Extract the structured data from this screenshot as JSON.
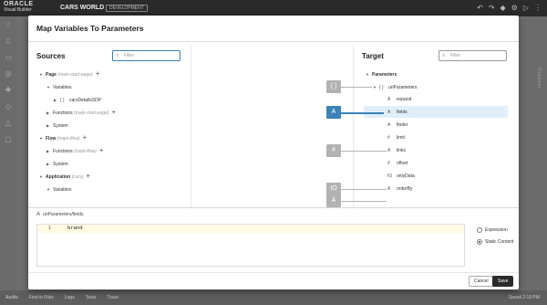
{
  "header": {
    "logo_top": "ORACLE",
    "logo_bottom": "Visual Builder",
    "app_name": "CARS WORLD",
    "env_badge": "DEVELOPMENT",
    "icons": [
      "undo-icon",
      "redo-icon",
      "diamond-icon",
      "gear-icon",
      "play-icon",
      "more-icon"
    ]
  },
  "right_rail": {
    "label": "Properties"
  },
  "dialog": {
    "title": "Map Variables To Parameters",
    "sources": {
      "title": "Sources",
      "filter_placeholder": "Filter",
      "tree": [
        {
          "label": "Page",
          "ctx": "(main-start-page)",
          "add": "+"
        },
        {
          "label": "Variables"
        },
        {
          "label": "carsDetailsSDP"
        },
        {
          "label": "Functions",
          "ctx": "(main-start-page)",
          "add": "+"
        },
        {
          "label": "System"
        },
        {
          "label": "Flow",
          "ctx": "(main-flow)",
          "add": "+"
        },
        {
          "label": "Functions",
          "ctx": "(main-flow)",
          "add": "+"
        },
        {
          "label": "System"
        },
        {
          "label": "Application",
          "ctx": "(cars)",
          "add": "+"
        },
        {
          "label": "Variables"
        }
      ]
    },
    "target": {
      "title": "Target",
      "filter_placeholder": "Filter",
      "tree": [
        {
          "label": "Parameters"
        },
        {
          "label": "uriParameters"
        },
        {
          "label": "expand"
        },
        {
          "label": "fields"
        },
        {
          "label": "finder"
        },
        {
          "label": "limit"
        },
        {
          "label": "links"
        },
        {
          "label": "offset"
        },
        {
          "label": "onlyData"
        },
        {
          "label": "orderBy"
        }
      ]
    },
    "mappings": [
      {
        "glyph": "{ }"
      },
      {
        "glyph": "A"
      },
      {
        "glyph": "#"
      },
      {
        "glyph": "IO"
      },
      {
        "glyph": "A"
      }
    ],
    "editor": {
      "path_label": "uriParameters/fields",
      "line_number": "1",
      "code": "brand",
      "options": [
        "Expression",
        "Static Content"
      ],
      "selected_option": "Static Content"
    },
    "buttons": {
      "cancel": "Cancel",
      "save": "Save"
    }
  },
  "statusbar": {
    "items": [
      "Audits",
      "Find in Files",
      "Logs",
      "Tests",
      "Trace"
    ],
    "saved": "Saved 2:19 PM"
  },
  "colors": {
    "accent": "#3b82b8",
    "header": "#2b2b2b",
    "selection": "#e1eef9"
  }
}
